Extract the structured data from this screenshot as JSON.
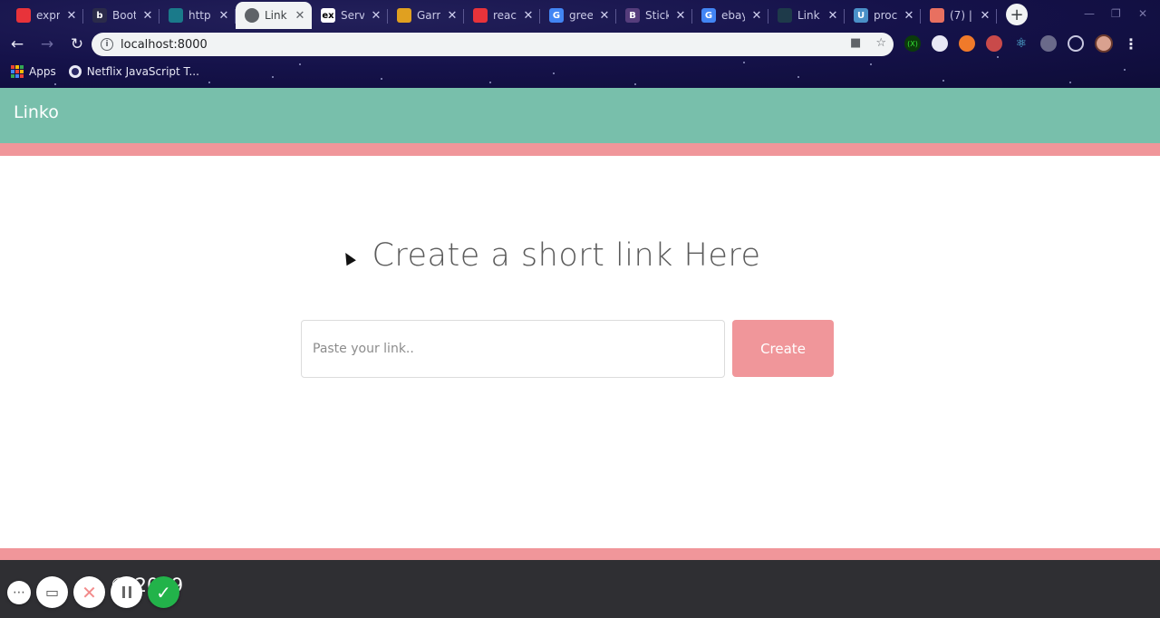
{
  "browser": {
    "tabs": [
      {
        "title": "expr",
        "icon": "tab-icon-red-square",
        "icon_color": "#e8333a",
        "icon_text": "",
        "active": false
      },
      {
        "title": "Boot",
        "icon": "tab-icon-b",
        "icon_color": "#2b2b4a",
        "icon_text": "b",
        "active": false
      },
      {
        "title": "http",
        "icon": "tab-icon-grid",
        "icon_color": "#1a7a8a",
        "icon_text": "",
        "active": false
      },
      {
        "title": "Link",
        "icon": "tab-icon-globe",
        "icon_color": "#5f6368",
        "icon_text": "",
        "active": true
      },
      {
        "title": "Serv",
        "icon": "tab-icon-ex",
        "icon_color": "#ffffff",
        "icon_text": "ex",
        "active": false
      },
      {
        "title": "Garr",
        "icon": "tab-icon-shop",
        "icon_color": "#e0a020",
        "icon_text": "",
        "active": false
      },
      {
        "title": "reac",
        "icon": "tab-icon-red-square",
        "icon_color": "#e8333a",
        "icon_text": "",
        "active": false
      },
      {
        "title": "gree",
        "icon": "tab-icon-google",
        "icon_color": "#4285f4",
        "icon_text": "G",
        "active": false
      },
      {
        "title": "Stick",
        "icon": "tab-icon-bootstrap",
        "icon_color": "#563d7c",
        "icon_text": "B",
        "active": false
      },
      {
        "title": "ebay",
        "icon": "tab-icon-google",
        "icon_color": "#4285f4",
        "icon_text": "G",
        "active": false
      },
      {
        "title": "Link",
        "icon": "tab-icon-react",
        "icon_color": "#1e3a4a",
        "icon_text": "",
        "active": false
      },
      {
        "title": "proc",
        "icon": "tab-icon-udemy",
        "icon_color": "#4a90c8",
        "icon_text": "U",
        "active": false
      },
      {
        "title": "(7) |",
        "icon": "tab-icon-spiral",
        "icon_color": "#e87060",
        "icon_text": "",
        "active": false
      }
    ],
    "url": "localhost:8000",
    "bookmarks": {
      "apps_label": "Apps",
      "item_label": "Netflix JavaScript T..."
    }
  },
  "page": {
    "brand": "Linko",
    "headline": "Create a short link Here",
    "input": {
      "placeholder": "Paste your link..",
      "value": ""
    },
    "create_label": "Create",
    "footer": "© 2019",
    "colors": {
      "navbar": "#78bfab",
      "accent_pink": "#f0969a",
      "footer_bg": "#2f2f33"
    }
  }
}
